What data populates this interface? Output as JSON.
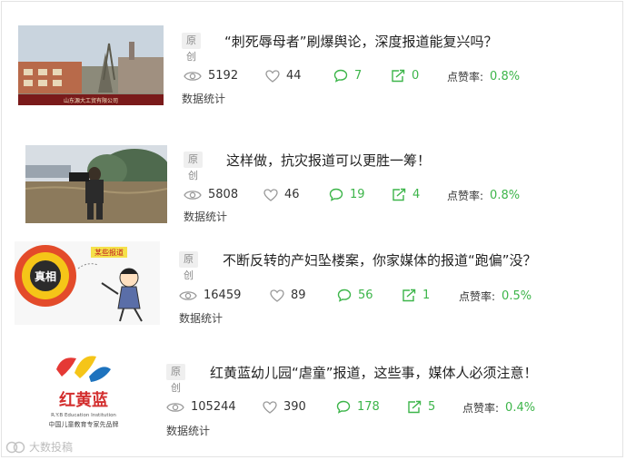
{
  "labels": {
    "original_tag": "原创",
    "rate_label": "点赞率:",
    "data_stats": "数据统计"
  },
  "articles": [
    {
      "title": "“刺死辱母者”刷爆舆论，深度报道能复兴吗？",
      "views": "5192",
      "likes": "44",
      "comments": "7",
      "shares": "0",
      "rate": "0.8%",
      "thumb": "factory-building-photo"
    },
    {
      "title": "这样做，抗灾报道可以更胜一筹！",
      "views": "5808",
      "likes": "46",
      "comments": "19",
      "shares": "4",
      "rate": "0.8%",
      "thumb": "flood-reporter-photo"
    },
    {
      "title": "不断反转的产妇坠楼案，你家媒体的报道“跑偏”没？",
      "views": "16459",
      "likes": "89",
      "comments": "56",
      "shares": "1",
      "rate": "0.5%",
      "thumb": "truth-target-cartoon",
      "thumb_text": {
        "target": "真相",
        "banner": "某些报道"
      }
    },
    {
      "title": "红黄蓝幼儿园“虐童”报道，这些事，媒体人必须注意！",
      "views": "105244",
      "likes": "390",
      "comments": "178",
      "shares": "5",
      "rate": "0.4%",
      "thumb": "rby-kindergarten-logo",
      "thumb_text": {
        "brand": "红黄蓝",
        "sub": "R.Y.B Education Institution",
        "slogan": "中国儿童教育专家先品牌"
      }
    }
  ],
  "watermark": "大数投稿",
  "colors": {
    "accent_green": "#3db54a",
    "icon_gray": "#9a9a9a",
    "tag_bg": "#efefef"
  }
}
